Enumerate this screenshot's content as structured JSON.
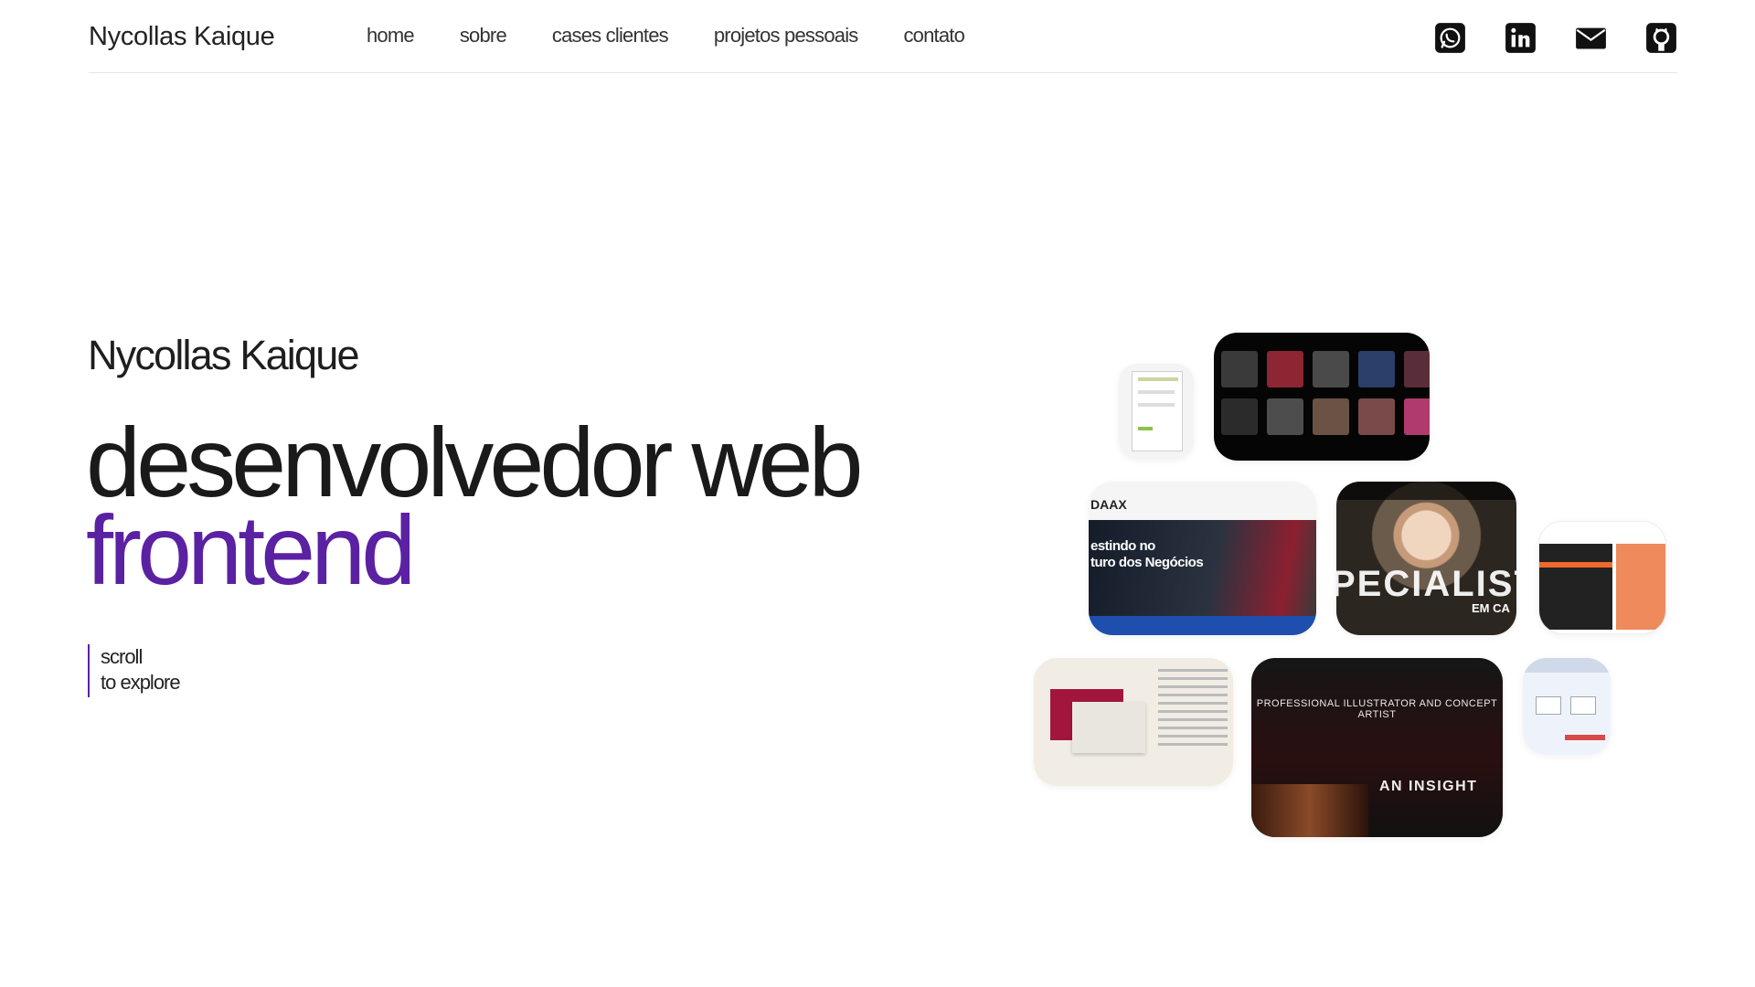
{
  "header": {
    "brand": "Nycollas Kaique",
    "nav": [
      "home",
      "sobre",
      "cases clientes",
      "projetos pessoais",
      "contato"
    ],
    "social": [
      "whatsapp-icon",
      "linkedin-icon",
      "mail-icon",
      "github-icon"
    ]
  },
  "hero": {
    "name": "Nycollas Kaique",
    "role_line1": "desenvolvedor web",
    "role_line2": "frontend",
    "scroll_line1": "scroll",
    "scroll_line2": "to explore"
  },
  "projects": {
    "daax_logo": "DAAX",
    "daax_headline": "estindo no\nturo dos Negócios",
    "specialist_big": "PECIALIST",
    "specialist_small": "EM CA",
    "illustrator_title": "PROFESSIONAL ILLUSTRATOR AND CONCEPT ARTIST",
    "illustrator_insight": "AN INSIGHT"
  },
  "colors": {
    "accent": "#5b21a3",
    "text": "#1a1a1a",
    "divider": "#e6e6e6"
  }
}
